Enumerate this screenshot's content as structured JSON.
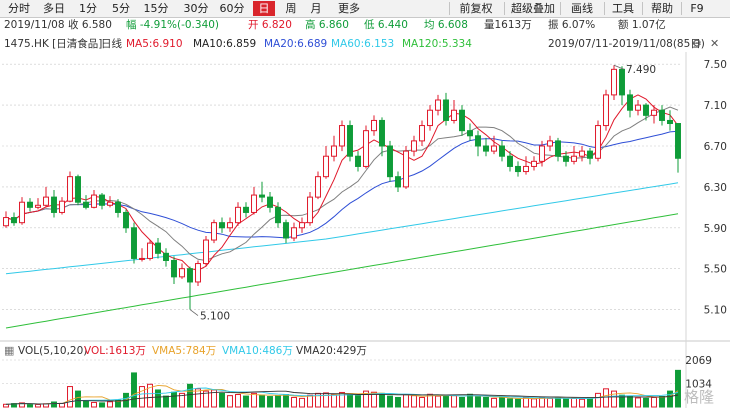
{
  "toolbar": {
    "tabs": [
      "分时",
      "多日",
      "1分",
      "5分",
      "15分",
      "30分",
      "60分",
      "日",
      "周",
      "月",
      "更多"
    ],
    "active_tab": "日",
    "right_buttons": [
      "前复权",
      "超级叠加",
      "画线",
      "工具",
      "帮助",
      "F9"
    ]
  },
  "status": {
    "date": "2019/11/08",
    "close": "收 6.580",
    "change": "幅 -4.91%(-0.340)",
    "open": "开 6.820",
    "high": "高 6.860",
    "low": "低 6.440",
    "avg": "均 6.608",
    "volume": "量1613万",
    "amplitude": "振 6.07%",
    "amount": "额 1.07亿"
  },
  "legend": {
    "stock": "1475.HK [日清食品]",
    "period": "日线",
    "ma5": "MA5:6.910",
    "ma10": "MA10:6.859",
    "ma20": "MA20:6.689",
    "ma60": "MA60:6.153",
    "ma120": "MA120:5.334",
    "range": "2019/07/11-2019/11/08(85日)"
  },
  "volume_legend": {
    "title": "VOL(5,10,20)",
    "vol": "VOL:1613万",
    "vma5": "VMA5:784万",
    "vma10": "VMA10:486万",
    "vma20": "VMA20:429万"
  },
  "watermark": "格隆",
  "colors": {
    "up": "#e0192b",
    "down": "#0f9c38",
    "ma5": "#e0192b",
    "ma10": "#7f7f7f",
    "ma20": "#2f4fd6",
    "ma60": "#31c9e8",
    "ma120": "#2fbf3a",
    "grid": "#c8c8c8"
  },
  "chart_data": {
    "type": "candlestick",
    "ylim": [
      4.9,
      7.6
    ],
    "y_ticks": [
      "7.50",
      "7.10",
      "6.70",
      "6.30",
      "5.90",
      "5.50",
      "5.10"
    ],
    "vol_ticks": [
      "2069",
      "1034"
    ],
    "high_annotation": "7.490",
    "low_annotation": "5.100",
    "candles": [
      [
        5.92,
        6.0,
        6.06,
        5.9
      ],
      [
        6.0,
        5.95,
        6.05,
        5.92
      ],
      [
        5.95,
        6.15,
        6.2,
        5.93
      ],
      [
        6.15,
        6.1,
        6.19,
        6.06
      ],
      [
        6.1,
        6.12,
        6.19,
        6.08
      ],
      [
        6.12,
        6.2,
        6.3,
        6.1
      ],
      [
        6.2,
        6.05,
        6.27,
        6.0
      ],
      [
        6.05,
        6.16,
        6.2,
        6.03
      ],
      [
        6.16,
        6.4,
        6.45,
        6.15
      ],
      [
        6.4,
        6.15,
        6.42,
        6.12
      ],
      [
        6.15,
        6.1,
        6.22,
        6.08
      ],
      [
        6.1,
        6.22,
        6.27,
        6.09
      ],
      [
        6.22,
        6.12,
        6.24,
        6.08
      ],
      [
        6.12,
        6.15,
        6.21,
        6.1
      ],
      [
        6.15,
        6.05,
        6.18,
        6.0
      ],
      [
        6.05,
        5.9,
        6.08,
        5.85
      ],
      [
        5.9,
        5.6,
        5.95,
        5.55
      ],
      [
        5.6,
        5.6,
        5.7,
        5.57
      ],
      [
        5.6,
        5.75,
        5.78,
        5.58
      ],
      [
        5.75,
        5.65,
        5.8,
        5.6
      ],
      [
        5.65,
        5.58,
        5.7,
        5.52
      ],
      [
        5.58,
        5.42,
        5.62,
        5.35
      ],
      [
        5.42,
        5.5,
        5.55,
        5.4
      ],
      [
        5.5,
        5.37,
        5.52,
        5.1
      ],
      [
        5.37,
        5.55,
        5.58,
        5.33
      ],
      [
        5.55,
        5.78,
        5.82,
        5.52
      ],
      [
        5.78,
        5.95,
        5.98,
        5.75
      ],
      [
        5.95,
        5.9,
        6.0,
        5.85
      ],
      [
        5.9,
        5.95,
        6.0,
        5.86
      ],
      [
        5.95,
        6.1,
        6.15,
        5.92
      ],
      [
        6.1,
        6.05,
        6.15,
        6.0
      ],
      [
        6.05,
        6.22,
        6.3,
        6.03
      ],
      [
        6.22,
        6.2,
        6.35,
        6.15
      ],
      [
        6.2,
        6.1,
        6.25,
        6.05
      ],
      [
        6.1,
        5.95,
        6.15,
        5.9
      ],
      [
        5.95,
        5.8,
        5.98,
        5.75
      ],
      [
        5.8,
        5.9,
        5.95,
        5.77
      ],
      [
        5.9,
        5.95,
        6.0,
        5.85
      ],
      [
        5.95,
        6.2,
        6.25,
        5.92
      ],
      [
        6.2,
        6.4,
        6.45,
        6.18
      ],
      [
        6.4,
        6.6,
        6.7,
        6.38
      ],
      [
        6.6,
        6.7,
        6.8,
        6.55
      ],
      [
        6.7,
        6.9,
        6.95,
        6.65
      ],
      [
        6.9,
        6.6,
        6.95,
        6.55
      ],
      [
        6.6,
        6.5,
        6.65,
        6.45
      ],
      [
        6.5,
        6.85,
        6.9,
        6.48
      ],
      [
        6.85,
        6.95,
        7.0,
        6.8
      ],
      [
        6.95,
        6.7,
        6.98,
        6.6
      ],
      [
        6.7,
        6.4,
        6.75,
        6.35
      ],
      [
        6.4,
        6.3,
        6.45,
        6.25
      ],
      [
        6.3,
        6.65,
        6.7,
        6.28
      ],
      [
        6.65,
        6.75,
        6.8,
        6.6
      ],
      [
        6.75,
        6.9,
        6.95,
        6.7
      ],
      [
        6.9,
        7.05,
        7.1,
        6.85
      ],
      [
        7.05,
        7.15,
        7.2,
        7.0
      ],
      [
        7.15,
        6.95,
        7.22,
        6.9
      ],
      [
        6.95,
        7.05,
        7.15,
        6.92
      ],
      [
        7.05,
        6.85,
        7.1,
        6.8
      ],
      [
        6.85,
        6.8,
        6.92,
        6.75
      ],
      [
        6.8,
        6.7,
        6.85,
        6.6
      ],
      [
        6.7,
        6.65,
        6.78,
        6.6
      ],
      [
        6.65,
        6.7,
        6.8,
        6.62
      ],
      [
        6.7,
        6.6,
        6.75,
        6.55
      ],
      [
        6.6,
        6.5,
        6.65,
        6.45
      ],
      [
        6.5,
        6.45,
        6.55,
        6.4
      ],
      [
        6.45,
        6.5,
        6.6,
        6.42
      ],
      [
        6.5,
        6.55,
        6.6,
        6.46
      ],
      [
        6.55,
        6.7,
        6.75,
        6.5
      ],
      [
        6.7,
        6.75,
        6.8,
        6.65
      ],
      [
        6.75,
        6.6,
        6.78,
        6.55
      ],
      [
        6.6,
        6.55,
        6.65,
        6.5
      ],
      [
        6.55,
        6.6,
        6.7,
        6.52
      ],
      [
        6.6,
        6.65,
        6.7,
        6.55
      ],
      [
        6.65,
        6.58,
        6.68,
        6.52
      ],
      [
        6.58,
        6.9,
        6.95,
        6.55
      ],
      [
        6.9,
        7.2,
        7.25,
        6.85
      ],
      [
        7.2,
        7.45,
        7.49,
        7.15
      ],
      [
        7.45,
        7.2,
        7.48,
        7.1
      ],
      [
        7.2,
        7.05,
        7.25,
        6.98
      ],
      [
        7.05,
        7.1,
        7.15,
        7.0
      ],
      [
        7.1,
        7.0,
        7.12,
        6.95
      ],
      [
        7.0,
        7.05,
        7.1,
        6.92
      ],
      [
        7.05,
        6.95,
        7.1,
        6.9
      ],
      [
        6.95,
        6.92,
        7.05,
        6.85
      ],
      [
        6.92,
        6.58,
        6.86,
        6.44
      ]
    ],
    "volumes": [
      120,
      150,
      180,
      130,
      110,
      140,
      220,
      160,
      900,
      700,
      260,
      200,
      180,
      230,
      300,
      600,
      1500,
      900,
      1000,
      750,
      480,
      650,
      600,
      1000,
      800,
      700,
      750,
      600,
      500,
      550,
      480,
      600,
      520,
      460,
      500,
      550,
      420,
      380,
      520,
      600,
      620,
      560,
      640,
      580,
      500,
      700,
      650,
      600,
      480,
      420,
      540,
      500,
      420,
      560,
      480,
      520,
      500,
      420,
      560,
      450,
      420,
      380,
      400,
      360,
      340,
      420,
      360,
      420,
      380,
      400,
      360,
      380,
      340,
      400,
      600,
      800,
      700,
      520,
      480,
      400,
      380,
      420,
      460,
      700,
      1613
    ]
  }
}
